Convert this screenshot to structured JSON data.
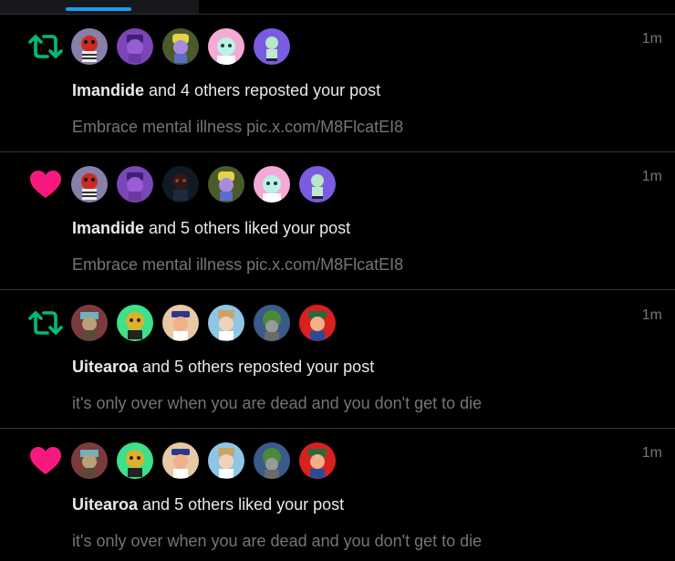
{
  "tabs": {
    "active_indicator_color": "#1d9bf0"
  },
  "colors": {
    "repost": "#00ba7c",
    "like": "#f91880",
    "text": "#e7e9ea",
    "muted": "#71767b"
  },
  "notifications": [
    {
      "type": "repost",
      "icon": "repost-icon",
      "actor": "Imandide",
      "action": " and 4 others reposted your post",
      "preview": "Embrace mental illness pic.x.com/M8FlcatEI8",
      "time": "1m",
      "avatar_count": 5
    },
    {
      "type": "like",
      "icon": "heart-icon",
      "actor": "Imandide",
      "action": " and 5 others liked your post",
      "preview": "Embrace mental illness pic.x.com/M8FlcatEI8",
      "time": "1m",
      "avatar_count": 6
    },
    {
      "type": "repost",
      "icon": "repost-icon",
      "actor": "Uitearoa",
      "action": " and 5 others reposted your post",
      "preview": "it's only over when you are dead and you don't get to die",
      "time": "1m",
      "avatar_count": 6
    },
    {
      "type": "like",
      "icon": "heart-icon",
      "actor": "Uitearoa",
      "action": " and 5 others liked your post",
      "preview": "it's only over when you are dead and you don't get to die",
      "time": "1m",
      "avatar_count": 6
    }
  ]
}
